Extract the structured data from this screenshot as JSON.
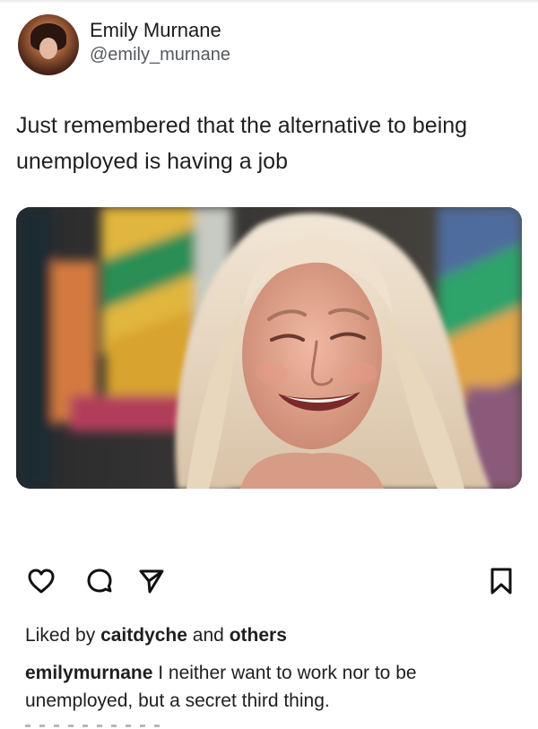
{
  "post": {
    "author": {
      "display_name": "Emily Murnane",
      "handle": "@emily_murnane"
    },
    "text": "Just remembered that the alternative to being unemployed is having a job",
    "media": {
      "type": "photo"
    }
  },
  "actions": {
    "icons": [
      "heart-icon",
      "comment-icon",
      "send-icon",
      "bookmark-icon"
    ]
  },
  "likes": {
    "prefix": "Liked by",
    "user": "caitdyche",
    "conjunction": "and",
    "others": "others"
  },
  "caption": {
    "username": "emilymurnane",
    "text": "I neither want to work nor to be unemployed, but a secret third thing."
  },
  "colors": {
    "text": "#1f1f1f",
    "secondary_text": "#555a60",
    "background": "#ffffff"
  }
}
